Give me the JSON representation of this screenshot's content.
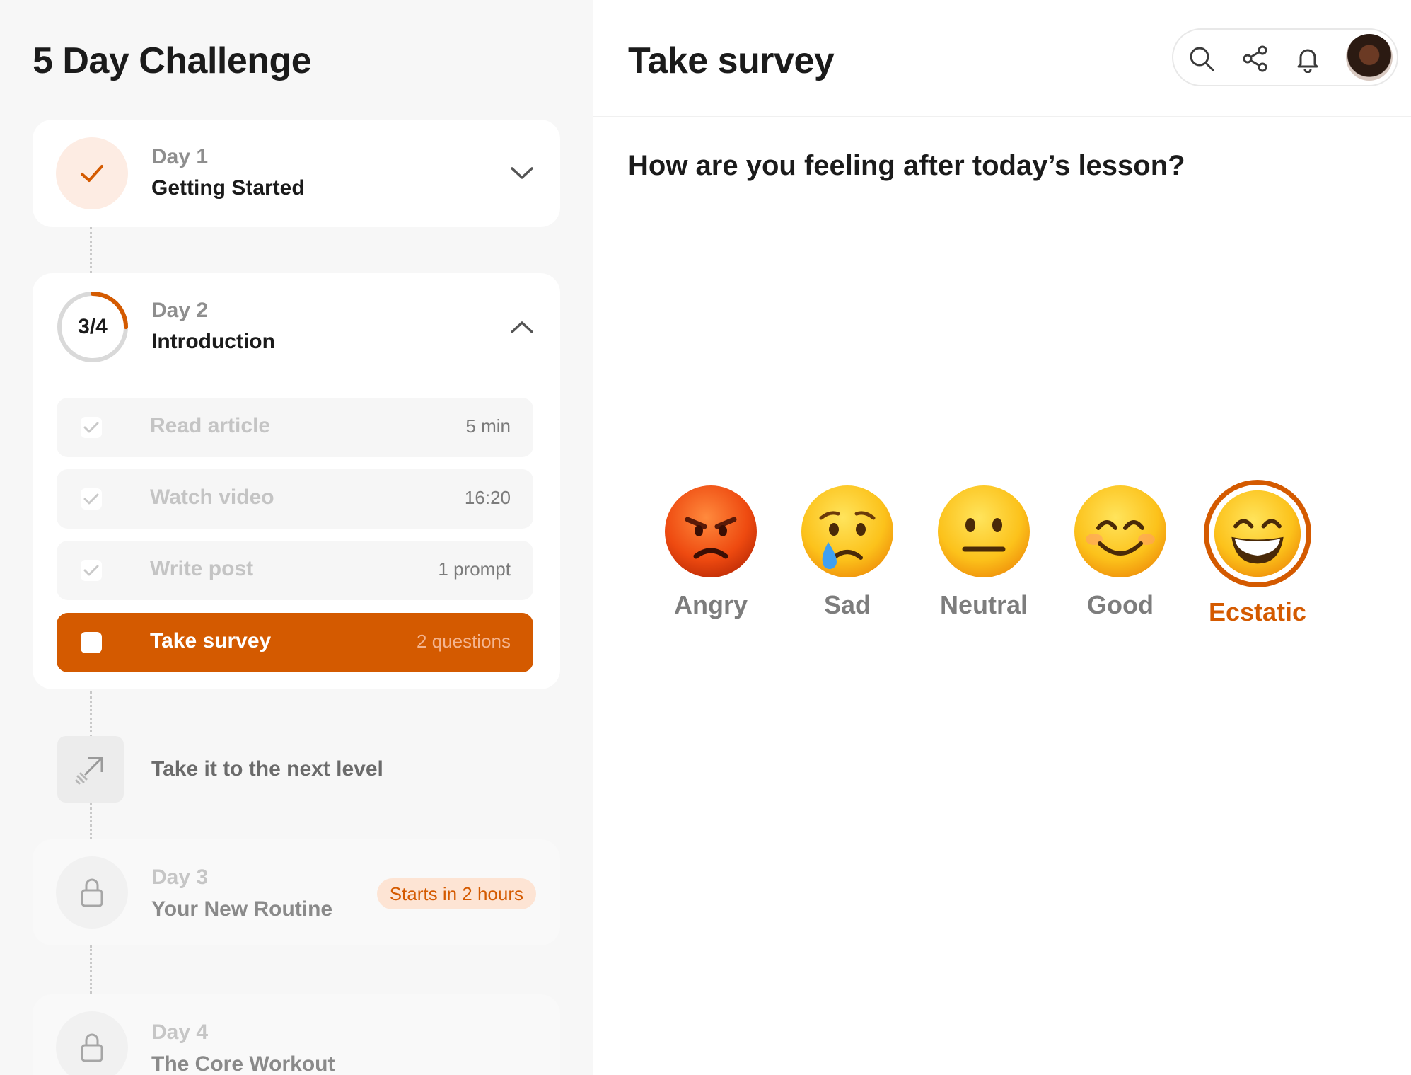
{
  "sidebar": {
    "title": "5 Day Challenge",
    "days": [
      {
        "kicker": "Day 1",
        "name": "Getting Started",
        "status": "done"
      },
      {
        "kicker": "Day 2",
        "name": "Introduction",
        "status": "in-progress",
        "progress": "3/4",
        "progress_fraction": 0.25
      },
      {
        "kicker": "Day 3",
        "name": "Your New Routine",
        "status": "locked",
        "badge": "Starts in 2 hours"
      },
      {
        "kicker": "Day 4",
        "name": "The Core Workout",
        "status": "locked"
      }
    ],
    "tasks": [
      {
        "label": "Read article",
        "meta": "5 min",
        "done": true
      },
      {
        "label": "Watch video",
        "meta": "16:20",
        "done": true
      },
      {
        "label": "Write post",
        "meta": "1 prompt",
        "done": true
      },
      {
        "label": "Take survey",
        "meta": "2 questions",
        "done": false,
        "active": true
      }
    ],
    "next_level_label": "Take it to the next level"
  },
  "main": {
    "title": "Take survey",
    "question": "How are you feeling after today’s lesson?",
    "moods": [
      {
        "label": "Angry",
        "icon": "angry-face-icon"
      },
      {
        "label": "Sad",
        "icon": "crying-face-icon"
      },
      {
        "label": "Neutral",
        "icon": "neutral-face-icon"
      },
      {
        "label": "Good",
        "icon": "smiling-face-icon"
      },
      {
        "label": "Ecstatic",
        "icon": "grinning-face-icon",
        "selected": true
      }
    ]
  },
  "toolbar": {
    "icons": [
      "search-icon",
      "share-icon",
      "bell-icon",
      "avatar"
    ]
  },
  "colors": {
    "accent": "#d45a00",
    "accent_light": "#fde4d4",
    "sidebar_bg": "#f7f7f7"
  }
}
